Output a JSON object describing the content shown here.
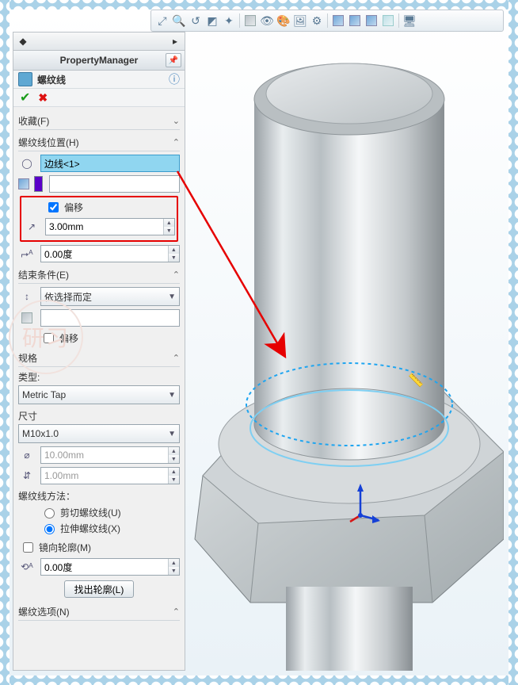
{
  "panel": {
    "title": "PropertyManager",
    "feature_name": "螺纹线",
    "sections": {
      "favorites": {
        "label": "收藏(F)"
      },
      "position": {
        "label": "螺纹线位置(H)",
        "edge_value": "边线<1>",
        "offset_label": "偏移",
        "offset_checked": true,
        "offset_value": "3.00mm",
        "angle_value": "0.00度"
      },
      "end_cond": {
        "label": "结束条件(E)",
        "combo": "依选择而定",
        "offset_label": "偏移",
        "offset_checked": false
      },
      "spec": {
        "label": "规格",
        "type_label": "类型:",
        "type_value": "Metric Tap",
        "size_label": "尺寸",
        "size_value": "M10x1.0",
        "diameter": "10.00mm",
        "pitch": "1.00mm",
        "method_label": "螺纹线方法：",
        "cut_label": "剪切螺纹线(U)",
        "extrude_label": "拉伸螺纹线(X)",
        "method_selected": "extrude",
        "mirror_label": "镜向轮廓(M)",
        "mirror_checked": false,
        "angle2": "0.00度",
        "locate_btn": "找出轮廓(L)"
      },
      "options": {
        "label": "螺纹选项(N)"
      }
    }
  },
  "icons": {
    "tb": [
      "zoom-fit",
      "zoom-area",
      "zoom-prev",
      "section",
      "view-orient",
      "display-style",
      "hide-show",
      "edit-appear",
      "scene",
      "view-settings",
      "render",
      "cube1",
      "cube2",
      "cube3",
      "cube4",
      "screen"
    ]
  }
}
